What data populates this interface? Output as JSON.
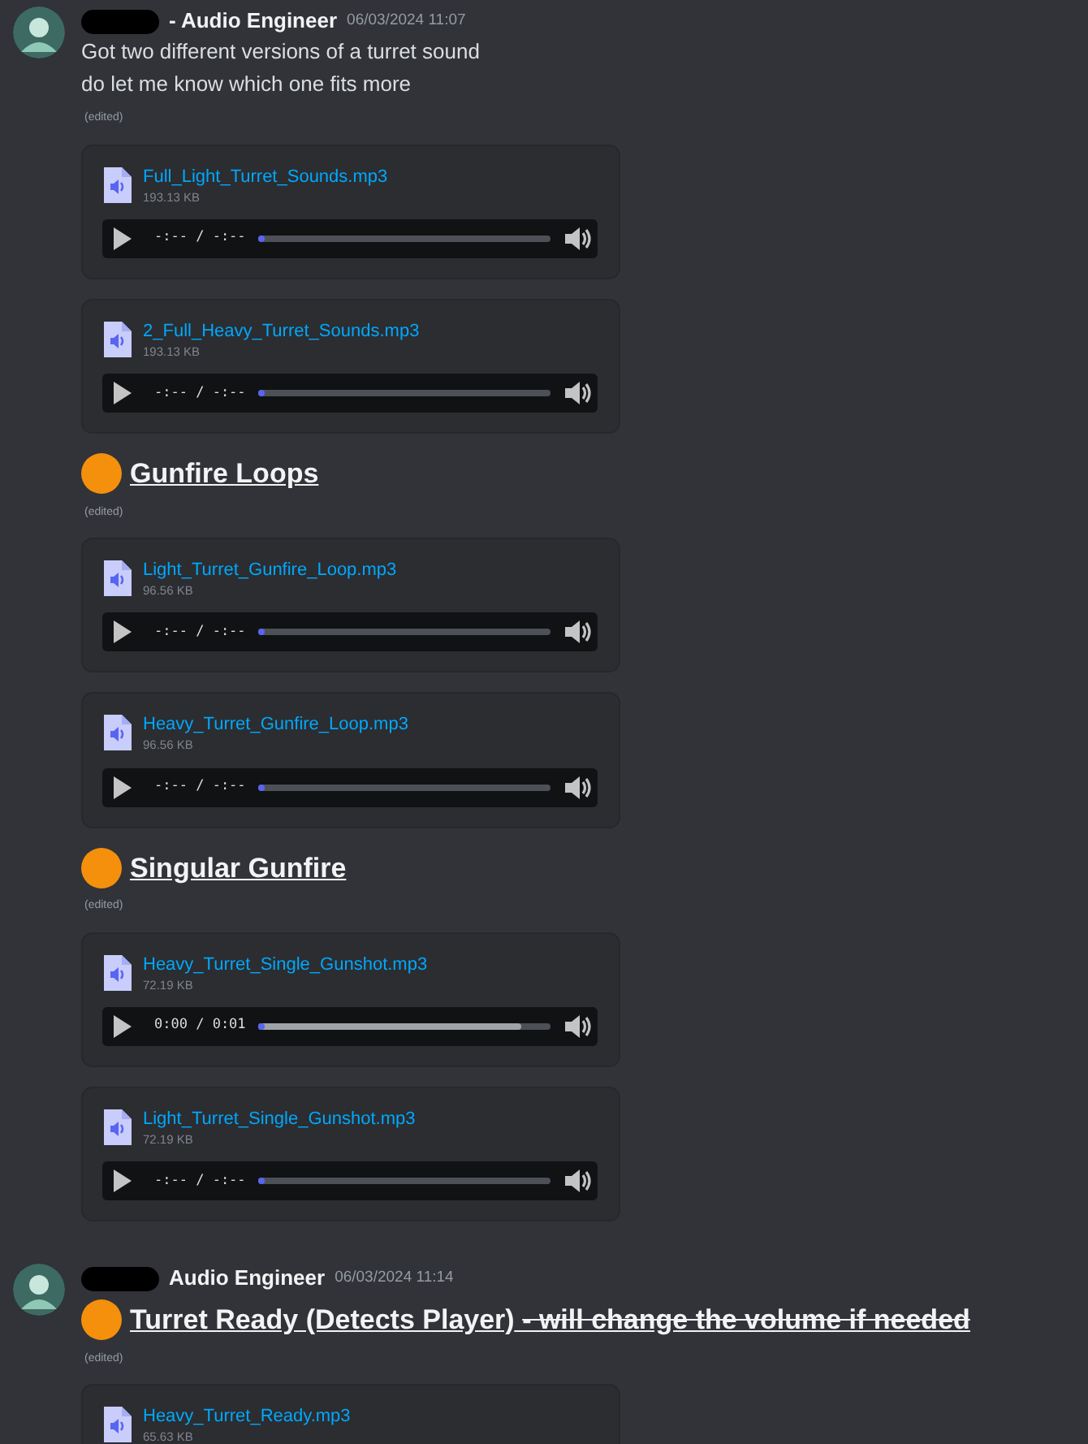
{
  "messages": [
    {
      "author": "- Audio Engineer",
      "timestamp": "06/03/2024 11:07",
      "blocks": [
        {
          "kind": "text",
          "text": "Got two different versions of a turret sound"
        },
        {
          "kind": "text",
          "text": "do let me know which one fits more"
        },
        {
          "kind": "edited",
          "text": "(edited)"
        },
        {
          "kind": "attachment",
          "file": "Full_Light_Turret_Sounds.mp3",
          "size": "193.13 KB",
          "player": {
            "time": "-:-- / -:--",
            "level": 0,
            "loaded": false
          }
        },
        {
          "kind": "attachment",
          "file": "2_Full_Heavy_Turret_Sounds.mp3",
          "size": "193.13 KB",
          "player": {
            "time": "-:-- / -:--",
            "level": 0,
            "loaded": false
          }
        },
        {
          "kind": "heading",
          "text": "Gunfire Loops"
        },
        {
          "kind": "edited",
          "text": "(edited)"
        },
        {
          "kind": "attachment",
          "file": "Light_Turret_Gunfire_Loop.mp3",
          "size": "96.56 KB",
          "player": {
            "time": "-:-- / -:--",
            "level": 0,
            "loaded": false
          }
        },
        {
          "kind": "attachment",
          "file": "Heavy_Turret_Gunfire_Loop.mp3",
          "size": "96.56 KB",
          "player": {
            "time": "-:-- / -:--",
            "level": 0,
            "loaded": false
          }
        },
        {
          "kind": "heading",
          "text": "Singular Gunfire"
        },
        {
          "kind": "edited",
          "text": "(edited)"
        },
        {
          "kind": "attachment",
          "file": "Heavy_Turret_Single_Gunshot.mp3",
          "size": "72.19 KB",
          "player": {
            "time": "0:00 / 0:01",
            "level": 0,
            "loaded": true
          }
        },
        {
          "kind": "attachment",
          "file": "Light_Turret_Single_Gunshot.mp3",
          "size": "72.19 KB",
          "player": {
            "time": "-:-- / -:--",
            "level": 0,
            "loaded": false
          }
        }
      ]
    },
    {
      "author": "Audio Engineer",
      "timestamp": "06/03/2024 11:14",
      "blocks": [
        {
          "kind": "heading",
          "text": "Turret Ready (Detects Player)",
          "struck_text": "- will change the volume if needed"
        },
        {
          "kind": "edited",
          "text": "(edited)"
        },
        {
          "kind": "attachment",
          "file": "Heavy_Turret_Ready.mp3",
          "size": "65.63 KB"
        }
      ]
    }
  ]
}
